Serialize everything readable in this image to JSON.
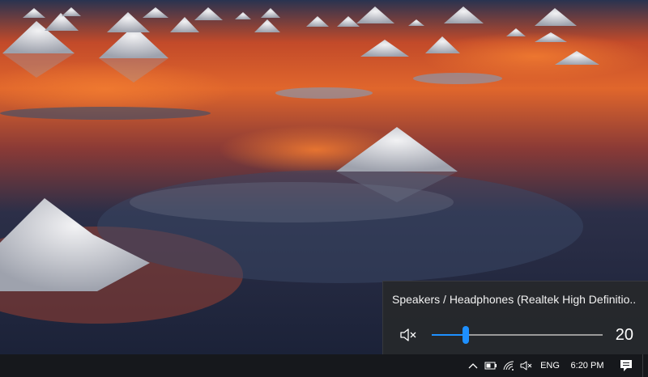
{
  "volume_flyout": {
    "device_name": "Speakers / Headphones (Realtek High Definitio...",
    "volume_value": "20",
    "volume_level_fraction": 0.2,
    "muted": true,
    "mute_icon": "speaker-mute-icon",
    "accent_color": "#1e90ff"
  },
  "taskbar": {
    "chevron_icon": "chevron-up-icon",
    "battery_icon": "battery-icon",
    "wifi_icon": "wifi-icon",
    "volume_icon": "speaker-mute-icon",
    "language": "ENG",
    "time": "6:20 PM",
    "notification_icon": "action-center-icon"
  }
}
